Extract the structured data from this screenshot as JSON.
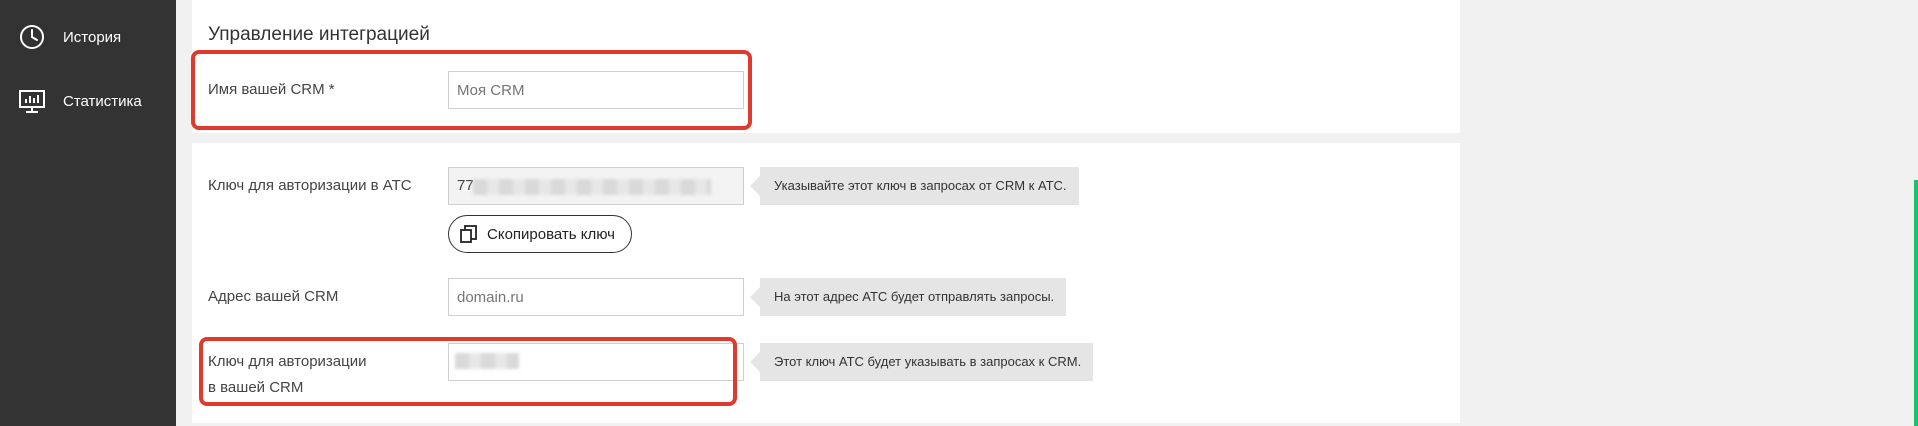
{
  "sidebar": {
    "items": [
      {
        "label": "История",
        "icon": "clock-history-icon"
      },
      {
        "label": "Статистика",
        "icon": "monitor-chart-icon"
      }
    ]
  },
  "section": {
    "title": "Управление интеграцией"
  },
  "crm_name": {
    "label": "Имя вашей CRM *",
    "placeholder": "Моя CRM",
    "value": ""
  },
  "ats_key": {
    "label": "Ключ для авторизации в АТС",
    "value_prefix": "77",
    "hint": "Указывайте этот ключ в запросах от CRM к АТС.",
    "copy_label": "Скопировать ключ"
  },
  "crm_address": {
    "label": "Адрес вашей CRM",
    "placeholder": "domain.ru",
    "hint": "На этот адрес АТС будет отправлять запросы."
  },
  "crm_key": {
    "label_line1": "Ключ для авторизации",
    "label_line2": "в вашей CRM",
    "hint": "Этот ключ АТС будет указывать в запросах к CRM."
  },
  "colors": {
    "sidebar_bg": "#333333",
    "annotation_red": "#e03a2f",
    "hint_bg": "#e5e5e5",
    "accent_green": "#19c26b"
  }
}
